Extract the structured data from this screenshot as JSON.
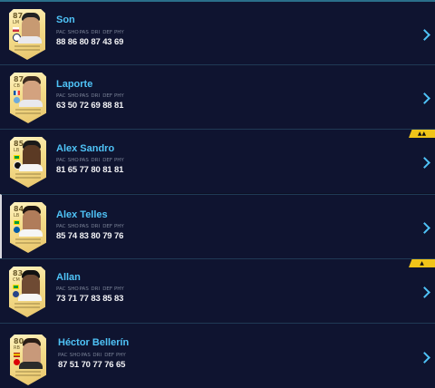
{
  "stat_labels": [
    "PAC",
    "SHO",
    "PAS",
    "DRI",
    "DEF",
    "PHY"
  ],
  "players": [
    {
      "name": "Son",
      "rating": "87",
      "position": "LM",
      "stats": [
        "88",
        "86",
        "80",
        "87",
        "43",
        "69"
      ],
      "tag": "",
      "flag_colors": [
        "#ffffff",
        "#cd2e3a"
      ],
      "badge_color": "#ffffff"
    },
    {
      "name": "Laporte",
      "rating": "87",
      "position": "CB",
      "stats": [
        "63",
        "50",
        "72",
        "69",
        "88",
        "81"
      ],
      "tag": "",
      "flag_colors": [
        "#0055a4",
        "#ef4135"
      ],
      "badge_color": "#6cabdd"
    },
    {
      "name": "Alex Sandro",
      "rating": "85",
      "position": "LB",
      "stats": [
        "81",
        "65",
        "77",
        "80",
        "81",
        "81"
      ],
      "tag": "",
      "flag_colors": [
        "#009c3b",
        "#ffdf00"
      ],
      "badge_color": "#111111"
    },
    {
      "name": "Alex Telles",
      "rating": "84",
      "position": "LB",
      "stats": [
        "85",
        "74",
        "83",
        "80",
        "79",
        "76"
      ],
      "tag": "",
      "flag_colors": [
        "#009c3b",
        "#ffdf00"
      ],
      "badge_color": "#005ca8"
    },
    {
      "name": "Allan",
      "rating": "83",
      "position": "CM",
      "stats": [
        "73",
        "71",
        "77",
        "83",
        "85",
        "83"
      ],
      "tag": "",
      "flag_colors": [
        "#009c3b",
        "#ffdf00"
      ],
      "badge_color": "#274488"
    },
    {
      "name": "Héctor Bellerín",
      "rating": "80",
      "position": "RB",
      "stats": [
        "87",
        "51",
        "70",
        "77",
        "76",
        "65"
      ],
      "tag": "",
      "flag_colors": [
        "#aa151b",
        "#f1bf00"
      ],
      "badge_color": "#db0007"
    }
  ],
  "colors": {
    "accent": "#4fc3f7",
    "background": "#0f1430",
    "tag": "#f0c419"
  }
}
